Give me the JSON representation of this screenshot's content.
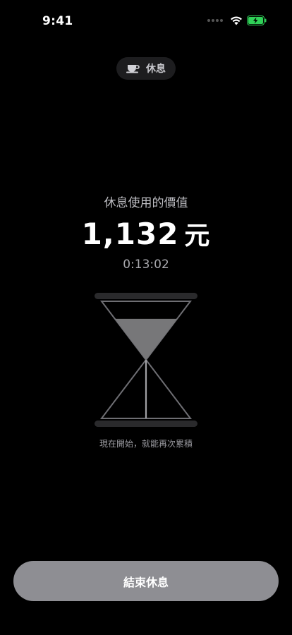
{
  "status_bar": {
    "time": "9:41",
    "icons": [
      "cellular-dots-icon",
      "wifi-icon",
      "battery-charging-icon"
    ],
    "battery_color": "#30d158"
  },
  "mode_chip": {
    "icon": "coffee-cup-icon",
    "label": "休息"
  },
  "value_title": "休息使用的價值",
  "value_amount": "1,132",
  "value_unit": "元",
  "elapsed_time": "0:13:02",
  "hourglass": {
    "icon": "hourglass-icon",
    "sand_top_fraction": 0.7,
    "sand_bottom_fraction": 0
  },
  "hint": "現在開始，就能再次累積",
  "end_button": {
    "label": "結束休息",
    "color": "#8e8e93"
  }
}
